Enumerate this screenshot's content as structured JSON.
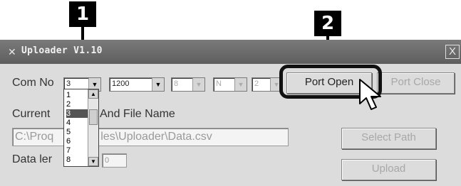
{
  "callouts": {
    "one": "1",
    "two": "2"
  },
  "window": {
    "title": "Uploader V1.10",
    "close_label": "X"
  },
  "com": {
    "label": "Com No",
    "selected": "3",
    "baud": "1200",
    "databits": "8",
    "parity": "N",
    "stopbits": "2",
    "options": [
      "1",
      "2",
      "3",
      "4",
      "5",
      "6",
      "7",
      "8"
    ]
  },
  "buttons": {
    "port_open": "Port Open",
    "port_close": "Port Close",
    "select_path": "Select Path",
    "upload": "Upload"
  },
  "path": {
    "label_left": "Current",
    "label_right": "And File Name",
    "value_left": "C:\\Proq",
    "value_right": "les\\Uploader\\Data.csv"
  },
  "data_length": {
    "label": "Data ler",
    "value": "0"
  }
}
